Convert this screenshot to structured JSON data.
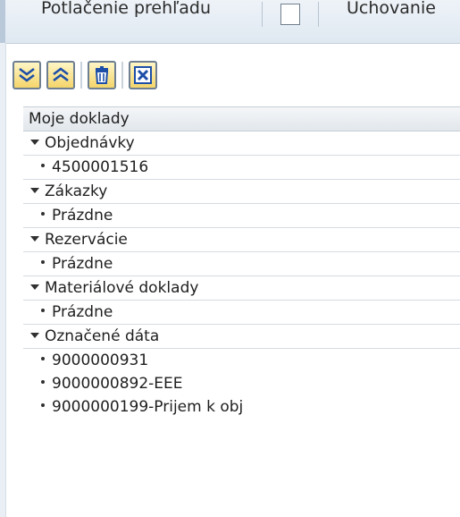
{
  "toolbar": {
    "item1_label": "Potlačenie prehľadu",
    "item2_label": "Uchovanie"
  },
  "icons": [
    "expand-all-icon",
    "collapse-all-icon",
    "delete-icon",
    "close-icon"
  ],
  "tree": {
    "header": "Moje doklady",
    "nodes": [
      {
        "label": "Objednávky",
        "items": [
          "4500001516"
        ]
      },
      {
        "label": "Zákazky",
        "items": [
          "Prázdne"
        ]
      },
      {
        "label": "Rezervácie",
        "items": [
          "Prázdne"
        ]
      },
      {
        "label": "Materiálové doklady",
        "items": [
          "Prázdne"
        ]
      },
      {
        "label": "Označené dáta",
        "items": [
          "9000000931",
          "9000000892-EEE",
          "9000000199-Prijem k obj"
        ]
      }
    ]
  },
  "colors": {
    "button_fill": "#f4d56a",
    "button_border": "#6e7f92",
    "toolbar_bg": "#dfe8f1",
    "header_bg": "#e2e7ec"
  }
}
